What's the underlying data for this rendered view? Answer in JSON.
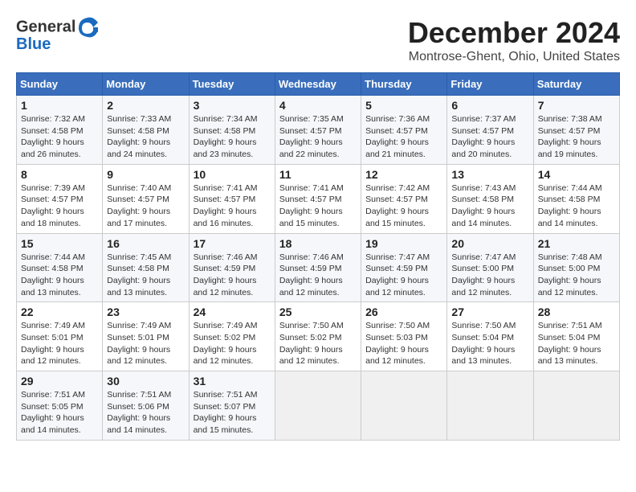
{
  "header": {
    "logo_line1": "General",
    "logo_line2": "Blue",
    "month": "December 2024",
    "location": "Montrose-Ghent, Ohio, United States"
  },
  "weekdays": [
    "Sunday",
    "Monday",
    "Tuesday",
    "Wednesday",
    "Thursday",
    "Friday",
    "Saturday"
  ],
  "weeks": [
    [
      {
        "day": "1",
        "sunrise": "Sunrise: 7:32 AM",
        "sunset": "Sunset: 4:58 PM",
        "daylight": "Daylight: 9 hours and 26 minutes."
      },
      {
        "day": "2",
        "sunrise": "Sunrise: 7:33 AM",
        "sunset": "Sunset: 4:58 PM",
        "daylight": "Daylight: 9 hours and 24 minutes."
      },
      {
        "day": "3",
        "sunrise": "Sunrise: 7:34 AM",
        "sunset": "Sunset: 4:58 PM",
        "daylight": "Daylight: 9 hours and 23 minutes."
      },
      {
        "day": "4",
        "sunrise": "Sunrise: 7:35 AM",
        "sunset": "Sunset: 4:57 PM",
        "daylight": "Daylight: 9 hours and 22 minutes."
      },
      {
        "day": "5",
        "sunrise": "Sunrise: 7:36 AM",
        "sunset": "Sunset: 4:57 PM",
        "daylight": "Daylight: 9 hours and 21 minutes."
      },
      {
        "day": "6",
        "sunrise": "Sunrise: 7:37 AM",
        "sunset": "Sunset: 4:57 PM",
        "daylight": "Daylight: 9 hours and 20 minutes."
      },
      {
        "day": "7",
        "sunrise": "Sunrise: 7:38 AM",
        "sunset": "Sunset: 4:57 PM",
        "daylight": "Daylight: 9 hours and 19 minutes."
      }
    ],
    [
      {
        "day": "8",
        "sunrise": "Sunrise: 7:39 AM",
        "sunset": "Sunset: 4:57 PM",
        "daylight": "Daylight: 9 hours and 18 minutes."
      },
      {
        "day": "9",
        "sunrise": "Sunrise: 7:40 AM",
        "sunset": "Sunset: 4:57 PM",
        "daylight": "Daylight: 9 hours and 17 minutes."
      },
      {
        "day": "10",
        "sunrise": "Sunrise: 7:41 AM",
        "sunset": "Sunset: 4:57 PM",
        "daylight": "Daylight: 9 hours and 16 minutes."
      },
      {
        "day": "11",
        "sunrise": "Sunrise: 7:41 AM",
        "sunset": "Sunset: 4:57 PM",
        "daylight": "Daylight: 9 hours and 15 minutes."
      },
      {
        "day": "12",
        "sunrise": "Sunrise: 7:42 AM",
        "sunset": "Sunset: 4:57 PM",
        "daylight": "Daylight: 9 hours and 15 minutes."
      },
      {
        "day": "13",
        "sunrise": "Sunrise: 7:43 AM",
        "sunset": "Sunset: 4:58 PM",
        "daylight": "Daylight: 9 hours and 14 minutes."
      },
      {
        "day": "14",
        "sunrise": "Sunrise: 7:44 AM",
        "sunset": "Sunset: 4:58 PM",
        "daylight": "Daylight: 9 hours and 14 minutes."
      }
    ],
    [
      {
        "day": "15",
        "sunrise": "Sunrise: 7:44 AM",
        "sunset": "Sunset: 4:58 PM",
        "daylight": "Daylight: 9 hours and 13 minutes."
      },
      {
        "day": "16",
        "sunrise": "Sunrise: 7:45 AM",
        "sunset": "Sunset: 4:58 PM",
        "daylight": "Daylight: 9 hours and 13 minutes."
      },
      {
        "day": "17",
        "sunrise": "Sunrise: 7:46 AM",
        "sunset": "Sunset: 4:59 PM",
        "daylight": "Daylight: 9 hours and 12 minutes."
      },
      {
        "day": "18",
        "sunrise": "Sunrise: 7:46 AM",
        "sunset": "Sunset: 4:59 PM",
        "daylight": "Daylight: 9 hours and 12 minutes."
      },
      {
        "day": "19",
        "sunrise": "Sunrise: 7:47 AM",
        "sunset": "Sunset: 4:59 PM",
        "daylight": "Daylight: 9 hours and 12 minutes."
      },
      {
        "day": "20",
        "sunrise": "Sunrise: 7:47 AM",
        "sunset": "Sunset: 5:00 PM",
        "daylight": "Daylight: 9 hours and 12 minutes."
      },
      {
        "day": "21",
        "sunrise": "Sunrise: 7:48 AM",
        "sunset": "Sunset: 5:00 PM",
        "daylight": "Daylight: 9 hours and 12 minutes."
      }
    ],
    [
      {
        "day": "22",
        "sunrise": "Sunrise: 7:49 AM",
        "sunset": "Sunset: 5:01 PM",
        "daylight": "Daylight: 9 hours and 12 minutes."
      },
      {
        "day": "23",
        "sunrise": "Sunrise: 7:49 AM",
        "sunset": "Sunset: 5:01 PM",
        "daylight": "Daylight: 9 hours and 12 minutes."
      },
      {
        "day": "24",
        "sunrise": "Sunrise: 7:49 AM",
        "sunset": "Sunset: 5:02 PM",
        "daylight": "Daylight: 9 hours and 12 minutes."
      },
      {
        "day": "25",
        "sunrise": "Sunrise: 7:50 AM",
        "sunset": "Sunset: 5:02 PM",
        "daylight": "Daylight: 9 hours and 12 minutes."
      },
      {
        "day": "26",
        "sunrise": "Sunrise: 7:50 AM",
        "sunset": "Sunset: 5:03 PM",
        "daylight": "Daylight: 9 hours and 12 minutes."
      },
      {
        "day": "27",
        "sunrise": "Sunrise: 7:50 AM",
        "sunset": "Sunset: 5:04 PM",
        "daylight": "Daylight: 9 hours and 13 minutes."
      },
      {
        "day": "28",
        "sunrise": "Sunrise: 7:51 AM",
        "sunset": "Sunset: 5:04 PM",
        "daylight": "Daylight: 9 hours and 13 minutes."
      }
    ],
    [
      {
        "day": "29",
        "sunrise": "Sunrise: 7:51 AM",
        "sunset": "Sunset: 5:05 PM",
        "daylight": "Daylight: 9 hours and 14 minutes."
      },
      {
        "day": "30",
        "sunrise": "Sunrise: 7:51 AM",
        "sunset": "Sunset: 5:06 PM",
        "daylight": "Daylight: 9 hours and 14 minutes."
      },
      {
        "day": "31",
        "sunrise": "Sunrise: 7:51 AM",
        "sunset": "Sunset: 5:07 PM",
        "daylight": "Daylight: 9 hours and 15 minutes."
      },
      null,
      null,
      null,
      null
    ]
  ]
}
